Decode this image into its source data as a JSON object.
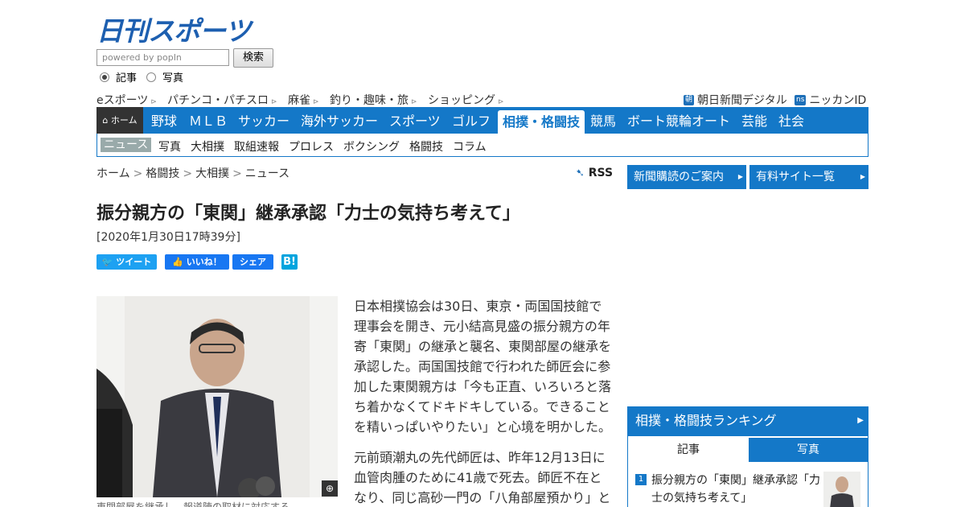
{
  "header": {
    "logo": "日刊スポーツ",
    "search_placeholder": "powered by popIn",
    "search_button": "検索",
    "radio_article": "記事",
    "radio_photo": "写真"
  },
  "toplinks": {
    "left": [
      "eスポーツ",
      "パチンコ・パチスロ",
      "麻雀",
      "釣り・趣味・旅",
      "ショッピング"
    ],
    "asahi_tag": "朝",
    "asahi": "朝日新聞デジタル",
    "nikkan_tag": "ns",
    "nikkan": "ニッカンID"
  },
  "nav": {
    "home": "ホーム",
    "items": [
      "野球",
      "ＭＬＢ",
      "サッカー",
      "海外サッカー",
      "スポーツ",
      "ゴルフ",
      "相撲・格闘技",
      "競馬",
      "ボート競輪オート",
      "芸能",
      "社会"
    ]
  },
  "subnav": [
    "ニュース",
    "写真",
    "大相撲",
    "取組速報",
    "プロレス",
    "ボクシング",
    "格闘技",
    "コラム"
  ],
  "breadcrumb": [
    "ホーム",
    "格闘技",
    "大相撲",
    "ニュース"
  ],
  "rss": "RSS",
  "article": {
    "title": "振分親方の「東関」継承承認「力士の気持ち考えて」",
    "date": "[2020年1月30日17時39分]",
    "caption": "東関部屋を継承し、報道陣の取材に対応する",
    "paragraphs": [
      "日本相撲協会は30日、東京・両国国技館で理事会を開き、元小結高見盛の振分親方の年寄「東関」の継承と襲名、東関部屋の継承を承認した。両国国技館で行われた師匠会に参加した東関親方は「今も正直、いろいろと落ち着かなくてドキドキしている。できることを精いっぱいやりたい」と心境を明かした。",
      "元前頭潮丸の先代師匠は、昨年12月13日に血管肉腫のために41歳で死去。師匠不在となり、同じ高砂一門の「八角部屋預かり」と"
    ]
  },
  "social": {
    "tweet": "ツイート",
    "like": "いいね！",
    "share": "シェア",
    "hatena": "B!"
  },
  "sidebar": {
    "subscribe": "新聞購読のご案内",
    "paid_sites": "有料サイト一覧",
    "ranking_title": "相撲・格闘技ランキング",
    "tab_article": "記事",
    "tab_photo": "写真",
    "rank1_num": "1",
    "rank1_text": "振分親方の「東関」継承承認「力士の気持ち考えて」"
  }
}
